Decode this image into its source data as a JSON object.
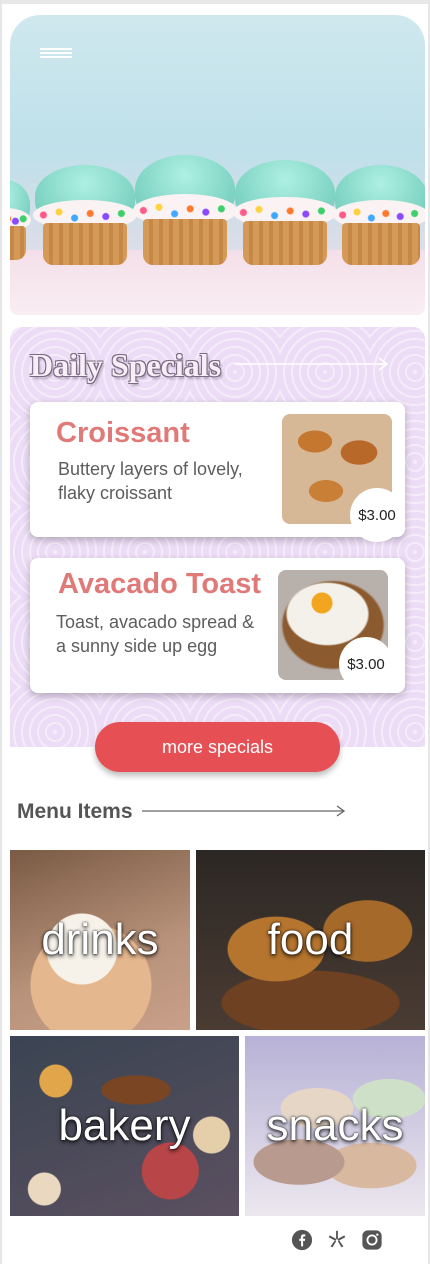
{
  "header": {
    "menu_icon": "hamburger-menu-icon"
  },
  "specials": {
    "title": "Daily Specials",
    "items": [
      {
        "name": "Croissant",
        "description": "Buttery layers of lovely, flaky croissant",
        "price": "$3.00"
      },
      {
        "name": "Avacado Toast",
        "description": "Toast, avacado spread & a sunny side up egg",
        "price": "$3.00"
      }
    ],
    "more_button": "more specials"
  },
  "menu": {
    "title": "Menu Items",
    "categories": [
      {
        "label": "drinks"
      },
      {
        "label": "food"
      },
      {
        "label": "bakery"
      },
      {
        "label": "snacks"
      }
    ]
  },
  "footer": {
    "social_icons": [
      "facebook-icon",
      "yelp-icon",
      "instagram-icon"
    ]
  },
  "colors": {
    "accent": "#e65054",
    "special_name": "#e07a78",
    "specials_bg": "#ecdcf6"
  }
}
